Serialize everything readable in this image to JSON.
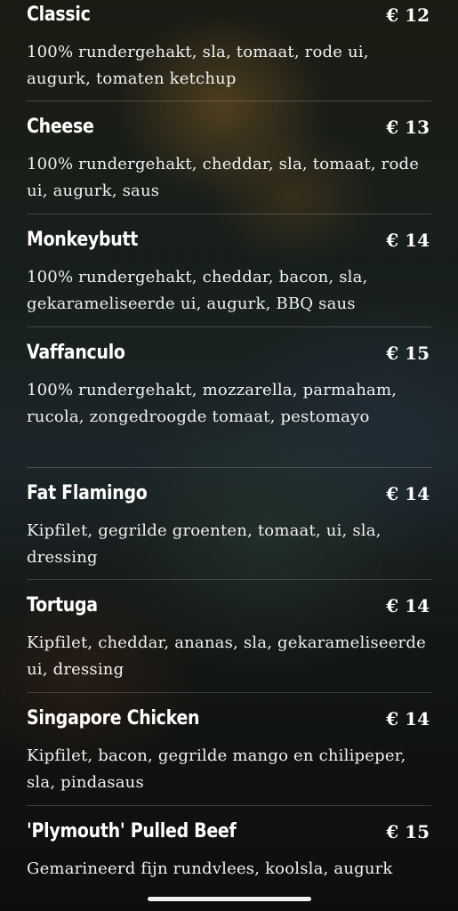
{
  "menu_items": [
    {
      "name": "Classic",
      "price": "€ 12",
      "description": "100% rundergehakt, sla, tomaat, rode ui, augurk, tomaten ketchup"
    },
    {
      "name": "Cheese",
      "price": "€ 13",
      "description": "100% rundergehakt, cheddar, sla, tomaat, rode ui, augurk, saus"
    },
    {
      "name": "Monkeybutt",
      "price": "€ 14",
      "description": "100% rundergehakt, cheddar, bacon, sla, gekarameliseerde ui, augurk, BBQ saus"
    },
    {
      "name": "Vaffanculo",
      "price": "€ 15",
      "description": "100% rundergehakt, mozzarella, parmaham, rucola, zongedroogde tomaat, pestomayo"
    },
    {
      "name": "Fat Flamingo",
      "price": "€ 14",
      "description": "Kipfilet, gegrilde groenten, tomaat, ui, sla, dressing"
    },
    {
      "name": "Tortuga",
      "price": "€ 14",
      "description": "Kipfilet, cheddar, ananas, sla, gekarameliseerde ui, dressing"
    },
    {
      "name": "Singapore Chicken",
      "price": "€ 14",
      "description": "Kipfilet, bacon, gegrilde mango en chilipeper, sla, pindasaus"
    },
    {
      "name": "'Plymouth' Pulled Beef",
      "price": "€ 15",
      "description": "Gemarineerd fijn rundvlees, koolsla, augurk"
    }
  ]
}
